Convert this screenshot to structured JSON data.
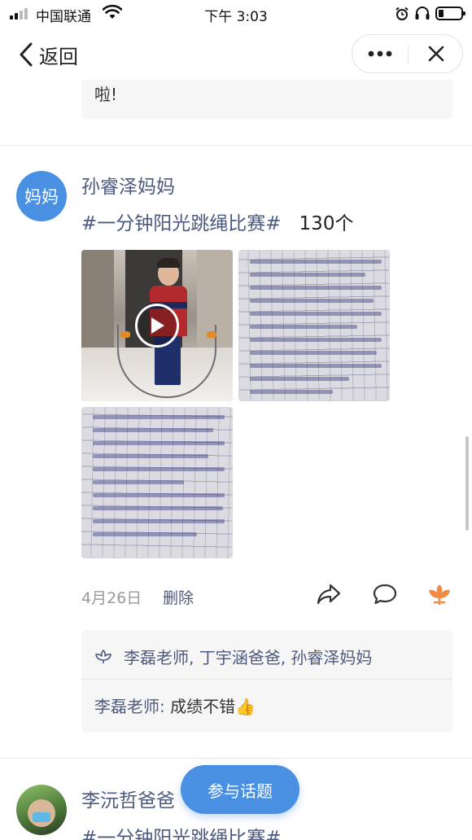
{
  "status_bar": {
    "carrier": "中国联通",
    "time": "下午 3:03"
  },
  "nav": {
    "back_label": "返回"
  },
  "previous_post": {
    "text_tail": "啦!"
  },
  "post": {
    "avatar_text": "妈妈",
    "author": "孙睿泽妈妈",
    "topic": "#一分钟阳光跳绳比赛#",
    "count": "130个",
    "media": [
      {
        "type": "video",
        "name": "jump-rope-video"
      },
      {
        "type": "image",
        "name": "handwritten-essay-page-1"
      },
      {
        "type": "image",
        "name": "handwritten-essay-page-2"
      }
    ],
    "date": "4月26日",
    "delete_label": "删除",
    "likes": "李磊老师, 丁宇涵爸爸, 孙睿泽妈妈",
    "comment": {
      "author": "李磊老师:",
      "text": "成绩不错",
      "emoji": "👍"
    }
  },
  "next_post": {
    "author": "李沅哲爸爸",
    "topic": "#一分钟阳光跳绳比赛#"
  },
  "fab_label": "参与话题",
  "colors": {
    "accent": "#4a90e2",
    "name_blue": "#4d5a80",
    "like_orange": "#f08a45"
  }
}
